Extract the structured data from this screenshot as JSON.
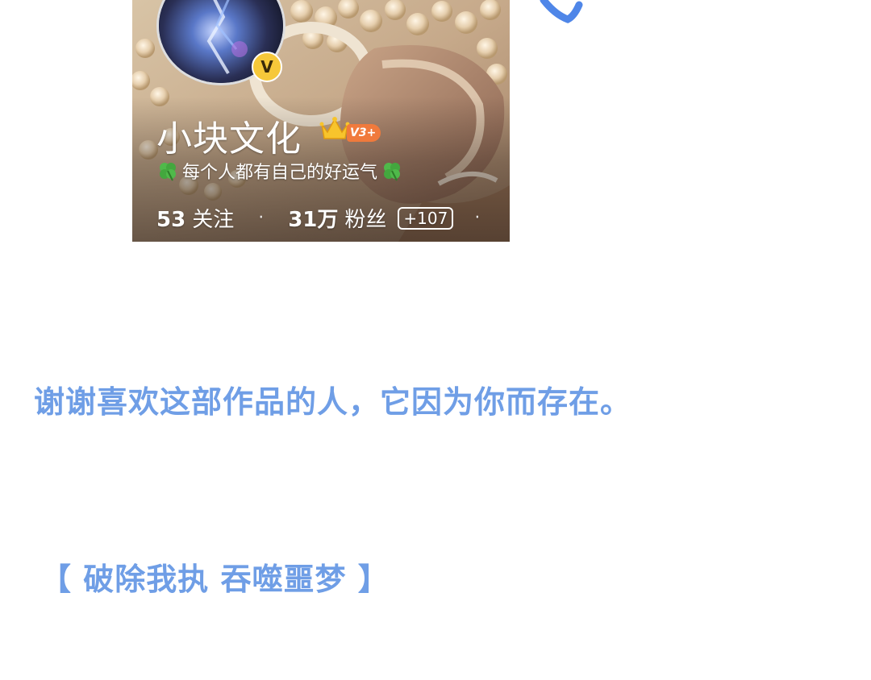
{
  "profile": {
    "username": "小块文化",
    "verified_mark": "V",
    "level_badge": "V3+",
    "bio": "每个人都有自己的好运气",
    "following_count": "53",
    "following_label": "关注",
    "fans_count": "31万",
    "fans_label": "粉丝",
    "fans_delta": "+107",
    "separator": "·"
  },
  "captions": {
    "thanks": "谢谢喜欢这部作品的人，它因为你而存在。",
    "slogan": "【 破除我执 吞噬噩梦 】"
  },
  "colors": {
    "caption_blue": "#6f9ee6",
    "badge_yellow": "#f6c83a",
    "level_orange": "#f07a3c"
  },
  "icons": {
    "verified": "verified-v-icon",
    "crown": "crown-icon",
    "clover": "four-leaf-clover-icon",
    "arrow": "arrow-scribble-icon"
  }
}
